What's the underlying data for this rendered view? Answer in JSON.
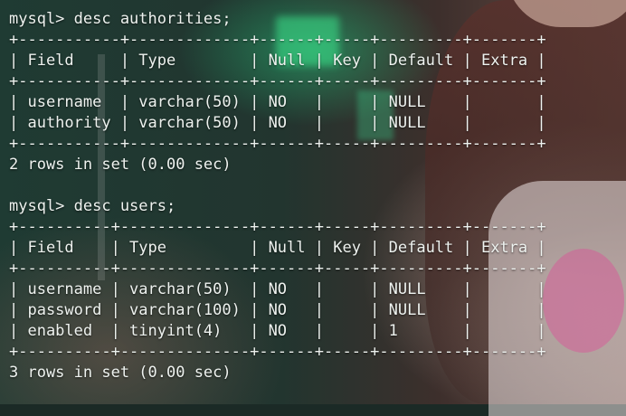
{
  "terminal": {
    "lines": [
      "mysql> desc authorities;",
      "+-----------+-------------+------+-----+---------+-------+",
      "| Field     | Type        | Null | Key | Default | Extra |",
      "+-----------+-------------+------+-----+---------+-------+",
      "| username  | varchar(50) | NO   |     | NULL    |       |",
      "| authority | varchar(50) | NO   |     | NULL    |       |",
      "+-----------+-------------+------+-----+---------+-------+",
      "2 rows in set (0.00 sec)",
      "",
      "mysql> desc users;",
      "+----------+--------------+------+-----+---------+-------+",
      "| Field    | Type         | Null | Key | Default | Extra |",
      "+----------+--------------+------+-----+---------+-------+",
      "| username | varchar(50)  | NO   |     | NULL    |       |",
      "| password | varchar(100) | NO   |     | NULL    |       |",
      "| enabled  | tinyint(4)   | NO   |     | 1       |       |",
      "+----------+--------------+------+-----+---------+-------+",
      "3 rows in set (0.00 sec)"
    ]
  },
  "colors": {
    "text": "#eef2ef"
  }
}
